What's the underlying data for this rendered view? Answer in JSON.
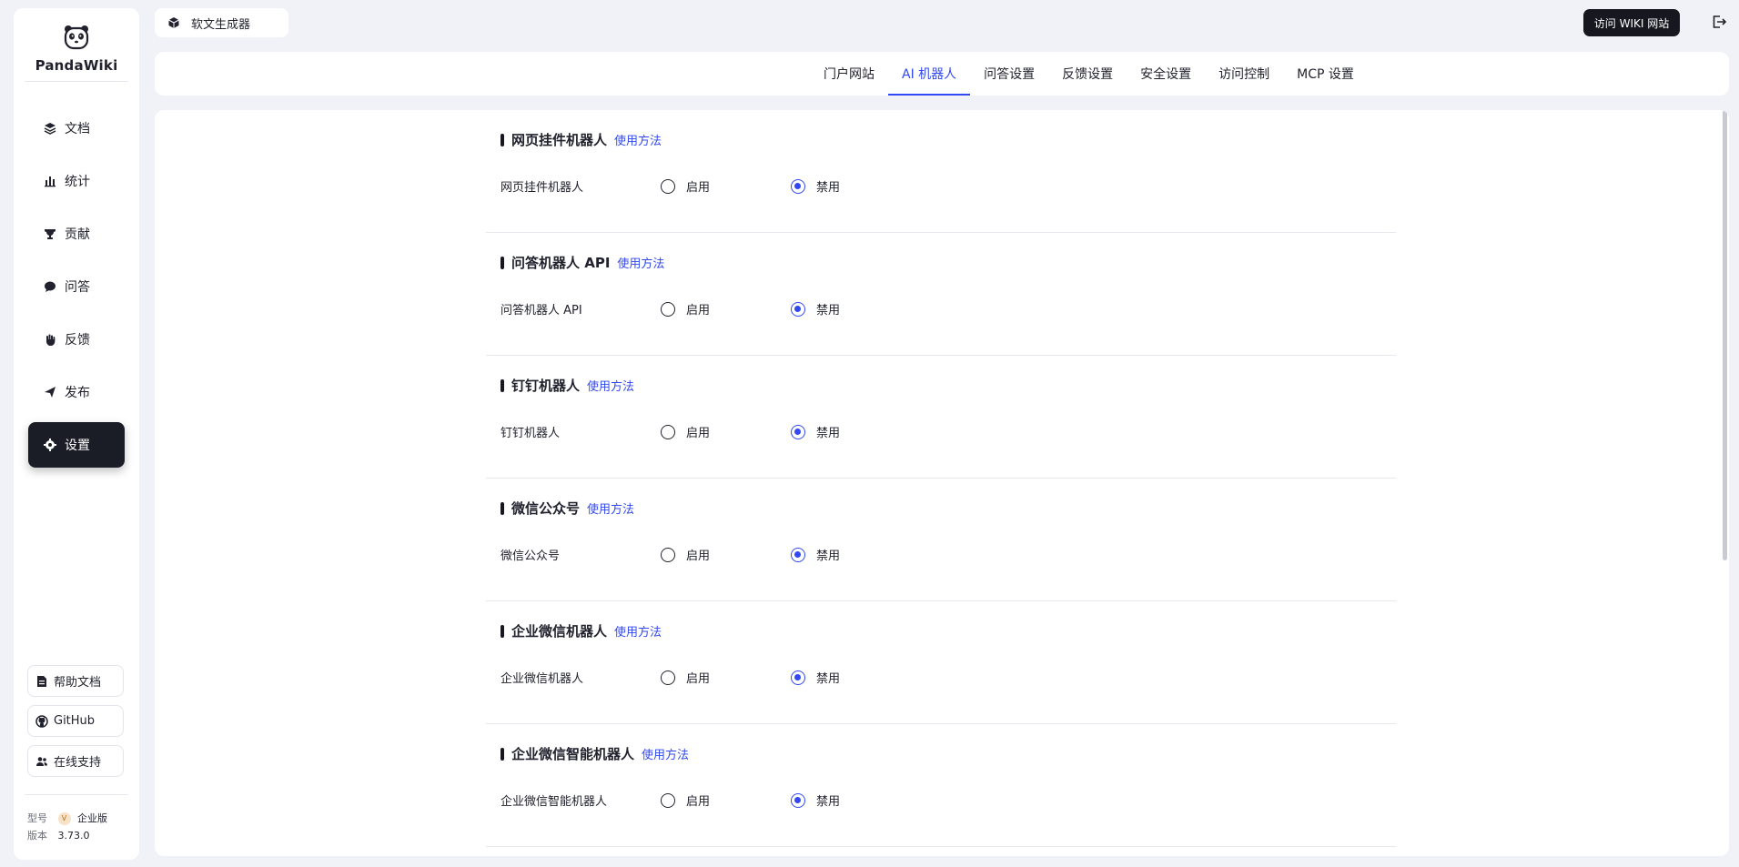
{
  "app": {
    "name": "PandaWiki"
  },
  "sidebar": {
    "items": [
      {
        "label": "文档",
        "icon": "layers-icon"
      },
      {
        "label": "统计",
        "icon": "bar-chart-icon"
      },
      {
        "label": "贡献",
        "icon": "trophy-icon"
      },
      {
        "label": "问答",
        "icon": "chat-bubble-icon"
      },
      {
        "label": "反馈",
        "icon": "hand-icon"
      },
      {
        "label": "发布",
        "icon": "send-icon"
      },
      {
        "label": "设置",
        "icon": "gear-icon",
        "active": true
      }
    ],
    "links": [
      {
        "label": "帮助文档",
        "icon": "doc-icon"
      },
      {
        "label": "GitHub",
        "icon": "github-icon"
      },
      {
        "label": "在线支持",
        "icon": "users-icon"
      }
    ],
    "meta": {
      "model_label": "型号",
      "model_value": "企业版",
      "version_label": "版本",
      "version_value": "3.73.0"
    }
  },
  "header": {
    "knowledge_base": "软文生成器",
    "visit_button": "访问 WIKI 网站"
  },
  "tabs": [
    {
      "label": "门户网站"
    },
    {
      "label": "AI 机器人",
      "active": true
    },
    {
      "label": "问答设置"
    },
    {
      "label": "反馈设置"
    },
    {
      "label": "安全设置"
    },
    {
      "label": "访问控制"
    },
    {
      "label": "MCP 设置"
    }
  ],
  "sections": [
    {
      "title": "网页挂件机器人",
      "link": "使用方法",
      "field_label": "网页挂件机器人",
      "on_label": "启用",
      "off_label": "禁用",
      "value": "禁用"
    },
    {
      "title": "问答机器人 API",
      "link": "使用方法",
      "field_label": "问答机器人 API",
      "on_label": "启用",
      "off_label": "禁用",
      "value": "禁用"
    },
    {
      "title": "钉钉机器人",
      "link": "使用方法",
      "field_label": "钉钉机器人",
      "on_label": "启用",
      "off_label": "禁用",
      "value": "禁用"
    },
    {
      "title": "微信公众号",
      "link": "使用方法",
      "field_label": "微信公众号",
      "on_label": "启用",
      "off_label": "禁用",
      "value": "禁用"
    },
    {
      "title": "企业微信机器人",
      "link": "使用方法",
      "field_label": "企业微信机器人",
      "on_label": "启用",
      "off_label": "禁用",
      "value": "禁用"
    },
    {
      "title": "企业微信智能机器人",
      "link": "使用方法",
      "field_label": "企业微信智能机器人",
      "on_label": "启用",
      "off_label": "禁用",
      "value": "禁用"
    }
  ],
  "colors": {
    "accent": "#3248f2",
    "dark": "#1b1d26",
    "background": "#f1f2f8"
  }
}
